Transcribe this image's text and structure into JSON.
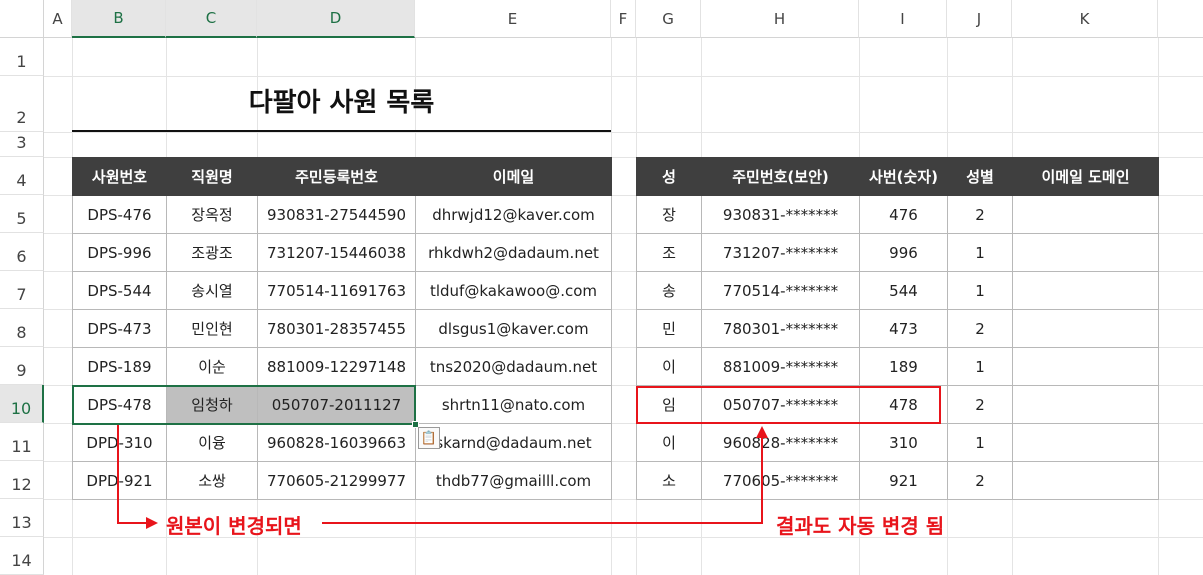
{
  "columns": [
    "A",
    "B",
    "C",
    "D",
    "E",
    "F",
    "G",
    "H",
    "I",
    "J",
    "K"
  ],
  "rows": [
    "1",
    "2",
    "3",
    "4",
    "5",
    "6",
    "7",
    "8",
    "9",
    "10",
    "11",
    "12",
    "13",
    "14"
  ],
  "title": "다팔아 사원 목록",
  "left_table": {
    "headers": [
      "사원번호",
      "직원명",
      "주민등록번호",
      "이메일"
    ],
    "rows": [
      [
        "DPS-476",
        "장옥정",
        "930831-27544590",
        "dhrwjd12@kaver.com"
      ],
      [
        "DPS-996",
        "조광조",
        "731207-15446038",
        "rhkdwh2@dadaum.net"
      ],
      [
        "DPS-544",
        "송시열",
        "770514-11691763",
        "tlduf@kakawoo@.com"
      ],
      [
        "DPS-473",
        "민인현",
        "780301-28357455",
        "dlsgus1@kaver.com"
      ],
      [
        "DPS-189",
        "이순",
        "881009-12297148",
        "tns2020@dadaum.net"
      ],
      [
        "DPS-478",
        "임청하",
        "050707-2011127",
        "shrtn11@nato.com"
      ],
      [
        "DPD-310",
        "이융",
        "960828-16039663",
        "skarnd@dadaum.net"
      ],
      [
        "DPD-921",
        "소쌍",
        "770605-21299977",
        "thdb77@gmailll.com"
      ]
    ]
  },
  "right_table": {
    "headers": [
      "성",
      "주민번호(보안)",
      "사번(숫자)",
      "성별",
      "이메일 도메인"
    ],
    "rows": [
      [
        "장",
        "930831-*******",
        "476",
        "2",
        ""
      ],
      [
        "조",
        "731207-*******",
        "996",
        "1",
        ""
      ],
      [
        "송",
        "770514-*******",
        "544",
        "1",
        ""
      ],
      [
        "민",
        "780301-*******",
        "473",
        "2",
        ""
      ],
      [
        "이",
        "881009-*******",
        "189",
        "1",
        ""
      ],
      [
        "임",
        "050707-*******",
        "478",
        "2",
        ""
      ],
      [
        "이",
        "960828-*******",
        "310",
        "1",
        ""
      ],
      [
        "소",
        "770605-*******",
        "921",
        "2",
        ""
      ]
    ]
  },
  "annotations": {
    "left": "원본이 변경되면",
    "right": "결과도 자동 변경 됨"
  },
  "paste_options_icon": "paste-options-icon",
  "colors": {
    "accent": "#1e7145",
    "annotation": "#e8141b",
    "header_bg": "#3f3f3f"
  }
}
